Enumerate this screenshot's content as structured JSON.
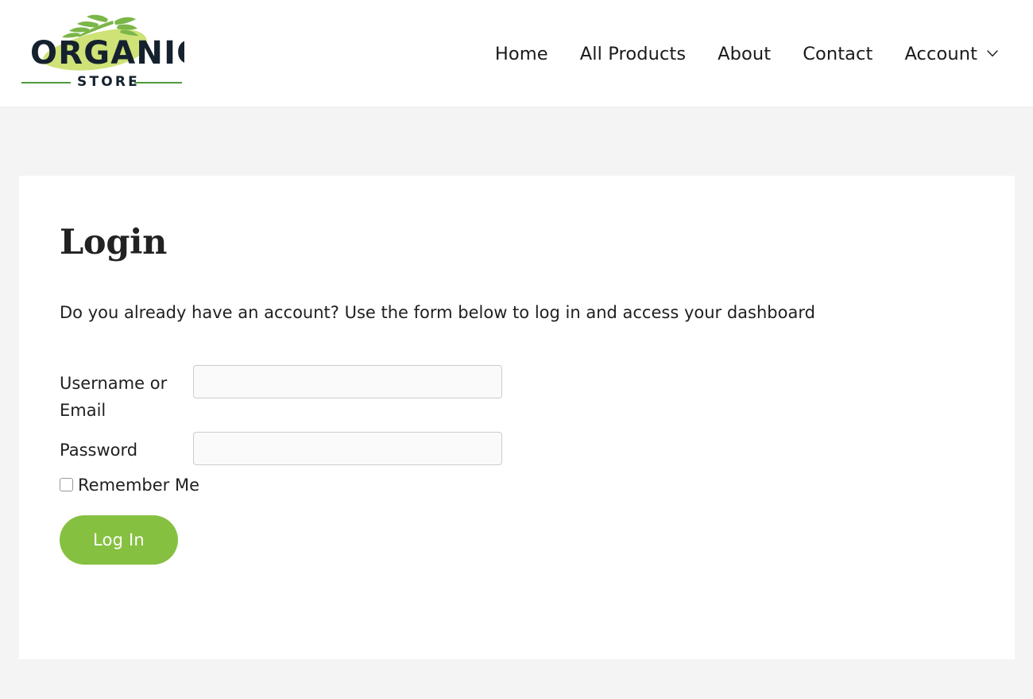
{
  "header": {
    "logo": {
      "name": "organic-store-logo",
      "primary_text": "Organic",
      "secondary_text": "STORE",
      "brush_color": "#cbe070",
      "leaf_color": "#7ab648",
      "text_color": "#15212e",
      "rule_color": "#4f9b3f"
    },
    "nav": [
      {
        "label": "Home",
        "name": "nav-item-home",
        "has_dropdown": false
      },
      {
        "label": "All Products",
        "name": "nav-item-all-products",
        "has_dropdown": false
      },
      {
        "label": "About",
        "name": "nav-item-about",
        "has_dropdown": false
      },
      {
        "label": "Contact",
        "name": "nav-item-contact",
        "has_dropdown": false
      },
      {
        "label": "Account",
        "name": "nav-item-account",
        "has_dropdown": true
      }
    ]
  },
  "main": {
    "title": "Login",
    "description": "Do you already have an account? Use the form below to log in and access your dashboard",
    "form": {
      "username": {
        "label": "Username or Email",
        "value": "",
        "placeholder": ""
      },
      "password": {
        "label": "Password",
        "value": "",
        "placeholder": ""
      },
      "remember": {
        "label": "Remember Me",
        "checked": false
      },
      "submit_label": "Log In",
      "submit_color": "#86c040"
    }
  },
  "colors": {
    "page_background": "#f4f4f4",
    "card_background": "#ffffff",
    "header_background": "#ffffff",
    "accent_green": "#86c040",
    "text": "#1f1f1f"
  }
}
